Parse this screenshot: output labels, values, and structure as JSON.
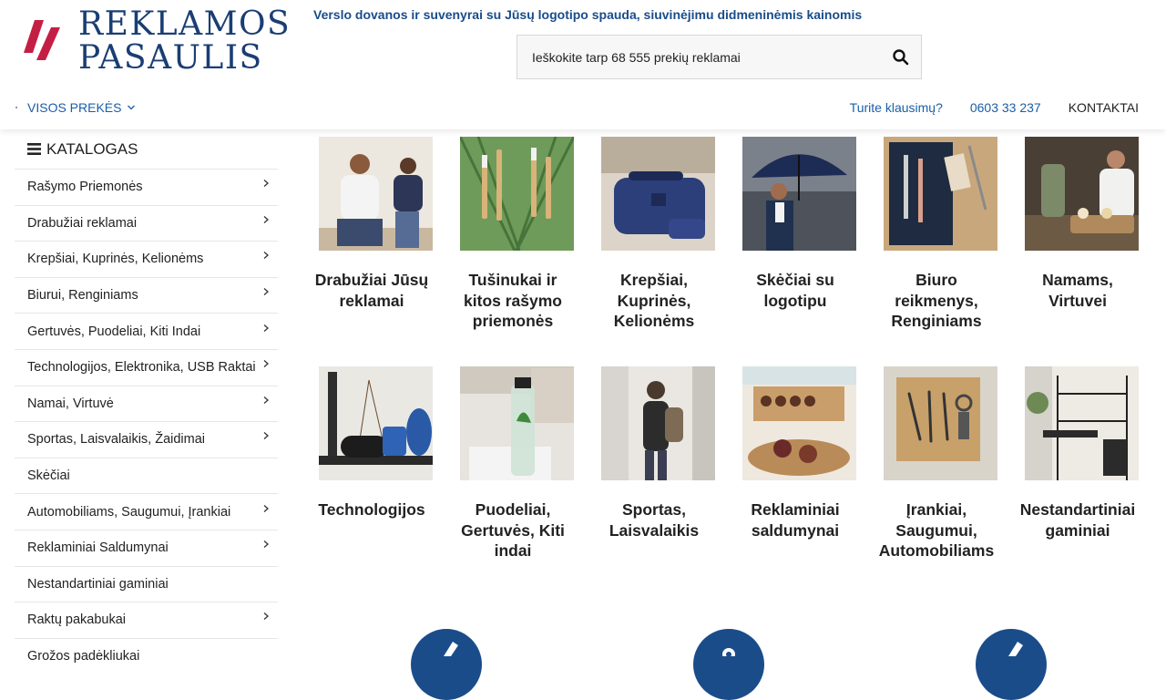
{
  "brand": {
    "line1": "REKLAMOS",
    "line2": "PASAULIS",
    "accent": "#c41e45",
    "primary": "#1a3e73"
  },
  "tagline": "Verslo dovanos ir suvenyrai su Jūsų logotipo spauda, siuvinėjimu didmeninėmis kainomis",
  "search": {
    "placeholder": "Ieškokite tarp 68 555 prekių reklamai",
    "value": ""
  },
  "nav": {
    "all_products": "VISOS PREKĖS",
    "questions": "Turite klausimų?",
    "phone": "0603 33 237",
    "contacts": "KONTAKTAI"
  },
  "sidebar": {
    "title": "KATALOGAS",
    "items": [
      {
        "label": "Rašymo Priemonės",
        "has_children": true
      },
      {
        "label": "Drabužiai reklamai",
        "has_children": true
      },
      {
        "label": "Krepšiai, Kuprinės, Kelionėms",
        "has_children": true
      },
      {
        "label": "Biurui, Renginiams",
        "has_children": true
      },
      {
        "label": "Gertuvės, Puodeliai, Kiti Indai",
        "has_children": true
      },
      {
        "label": "Technologijos, Elektronika, USB Raktai",
        "has_children": true
      },
      {
        "label": "Namai, Virtuvė",
        "has_children": true
      },
      {
        "label": "Sportas, Laisvalaikis, Žaidimai",
        "has_children": true
      },
      {
        "label": "Skėčiai",
        "has_children": false
      },
      {
        "label": "Automobiliams, Saugumui, Įrankiai",
        "has_children": true
      },
      {
        "label": "Reklaminiai Saldumynai",
        "has_children": true
      },
      {
        "label": "Nestandartiniai gaminiai",
        "has_children": false
      },
      {
        "label": "Raktų pakabukai",
        "has_children": true
      },
      {
        "label": "Grožos padėkliukai",
        "has_children": false
      }
    ]
  },
  "categories": [
    {
      "name": "Drabužiai Jūsų reklamai",
      "icon": "people-shirts-image"
    },
    {
      "name": "Tušinukai ir kitos rašymo priemonės",
      "icon": "pens-image"
    },
    {
      "name": "Krepšiai, Kuprinės, Kelionėms",
      "icon": "bag-image"
    },
    {
      "name": "Skėčiai su logotipu",
      "icon": "umbrella-image"
    },
    {
      "name": "Biuro reikmenys, Renginiams",
      "icon": "notebook-image"
    },
    {
      "name": "Namams, Virtuvei",
      "icon": "kitchen-image"
    },
    {
      "name": "Technologijos",
      "icon": "speaker-image"
    },
    {
      "name": "Puodeliai, Gertuvės, Kiti indai",
      "icon": "bottle-image"
    },
    {
      "name": "Sportas, Laisvalaikis",
      "icon": "backpack-image"
    },
    {
      "name": "Reklaminiai saldumynai",
      "icon": "sweets-image"
    },
    {
      "name": "Įrankiai, Saugumui, Automobiliams",
      "icon": "tools-image"
    },
    {
      "name": "Nestandartiniai gaminiai",
      "icon": "shelf-image"
    }
  ]
}
